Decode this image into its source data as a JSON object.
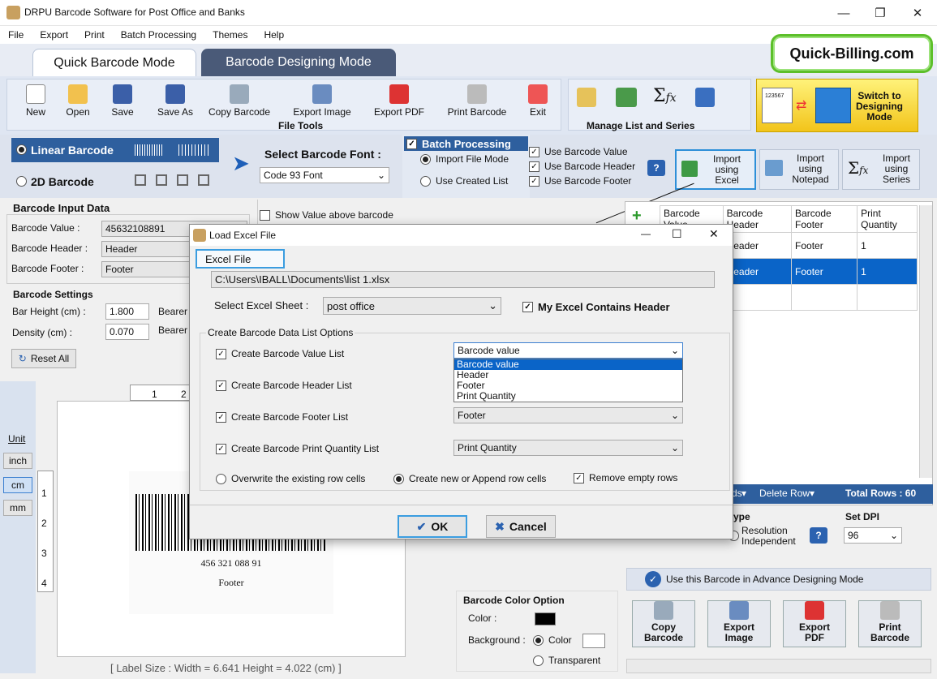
{
  "window": {
    "title": "DRPU Barcode Software for Post Office and Banks",
    "minimize": "—",
    "maximize": "❐",
    "close": "✕"
  },
  "menu": [
    "File",
    "Export",
    "Print",
    "Batch Processing",
    "Themes",
    "Help"
  ],
  "tabs": {
    "quick": "Quick Barcode Mode",
    "designing": "Barcode Designing Mode"
  },
  "brand": "Quick-Billing.com",
  "file_tools": {
    "label": "File Tools",
    "buttons": [
      "New",
      "Open",
      "Save",
      "Save As",
      "Copy Barcode",
      "Export Image",
      "Export PDF",
      "Print Barcode",
      "Exit"
    ]
  },
  "manage": {
    "label": "Manage List and Series"
  },
  "switch": {
    "label": "Switch to Designing Mode",
    "line1": "Switch to",
    "line2": "Designing",
    "line3": "Mode",
    "preview_num": "123567"
  },
  "barcode_type": {
    "linear": "Linear Barcode",
    "twod": "2D Barcode"
  },
  "font": {
    "label": "Select Barcode Font :",
    "value": "Code 93 Font"
  },
  "batch": {
    "title": "Batch Processing",
    "import_mode": "Import File Mode",
    "created_list": "Use Created List",
    "use_value": "Use Barcode Value",
    "use_header": "Use Barcode Header",
    "use_footer": "Use Barcode Footer",
    "help": "?"
  },
  "imports": {
    "excel": [
      "Import",
      "using",
      "Excel"
    ],
    "notepad": [
      "Import",
      "using",
      "Notepad"
    ],
    "series": [
      "Import",
      "using",
      "Series"
    ]
  },
  "input": {
    "title": "Barcode Input Data",
    "value_label": "Barcode Value :",
    "value": "45632108891",
    "header_label": "Barcode Header :",
    "header": "Header",
    "footer_label": "Barcode Footer :",
    "footer": "Footer",
    "show_above": "Show Value above barcode"
  },
  "settings": {
    "title": "Barcode Settings",
    "bar_height_label": "Bar Height (cm) :",
    "bar_height": "1.800",
    "density_label": "Density (cm) :",
    "density": "0.070",
    "bearer1": "Bearer",
    "bearer2": "Bearer",
    "reset": "Reset All"
  },
  "units": {
    "label": "Unit",
    "inch": "inch",
    "cm": "cm",
    "mm": "mm"
  },
  "ruler": {
    "top": [
      "1",
      "2"
    ],
    "left": [
      "1",
      "2",
      "3",
      "4"
    ]
  },
  "preview": {
    "digits": "456 321 088 91",
    "footer": "Footer"
  },
  "status": "[ Label Size : Width = 6.641  Height = 4.022 (cm) ]",
  "table": {
    "add": "+",
    "headers": [
      "Barcode Value",
      "Barcode Header",
      "Barcode Footer",
      "Print Quantity"
    ],
    "rows": [
      [
        "",
        "Header",
        "Footer",
        "1"
      ],
      [
        "",
        "Header",
        "Footer",
        "1"
      ]
    ],
    "actions_fragment": "rds",
    "delete_row": "Delete Row",
    "total": "Total Rows : 60"
  },
  "resolution": {
    "type_fragment": "ype",
    "label1": "Resolution",
    "label2": "Independent",
    "dpi_label": "Set DPI",
    "dpi": "96"
  },
  "advance": "Use this Barcode in Advance Designing Mode",
  "color": {
    "title": "Barcode Color Option",
    "color_label": "Color :",
    "background_label": "Background :",
    "color_opt": "Color",
    "transparent_opt": "Transparent"
  },
  "bottom_buttons": [
    [
      "Copy",
      "Barcode"
    ],
    [
      "Export",
      "Image"
    ],
    [
      "Export",
      "PDF"
    ],
    [
      "Print",
      "Barcode"
    ]
  ],
  "dialog": {
    "title": "Load Excel File",
    "section": "Excel File",
    "path": "C:\\Users\\IBALL\\Documents\\list 1.xlsx",
    "sheet_label": "Select Excel Sheet :",
    "sheet": "post office",
    "has_header": "My Excel Contains Header",
    "options_title": "Create Barcode Data List Options",
    "opt_value": "Create Barcode Value List",
    "opt_header": "Create Barcode Header List",
    "opt_footer": "Create Barcode Footer List",
    "opt_qty": "Create Barcode Print Quantity List",
    "value_select": "Barcode value",
    "dropdown_items": [
      "Barcode value",
      "Header",
      "Footer",
      "Print Quantity"
    ],
    "footer_select": "Footer",
    "qty_select": "Print Quantity",
    "overwrite": "Overwrite the existing row cells",
    "append": "Create new or Append row cells",
    "remove_empty": "Remove empty rows",
    "ok": "OK",
    "cancel": "Cancel"
  },
  "colors": {
    "accent": "#1e6fc8",
    "selected_row": "#0a64c8",
    "tab_active": "#ffffff",
    "tab_inactive": "#4a5a78",
    "batch_header": "#2e5f9e"
  }
}
